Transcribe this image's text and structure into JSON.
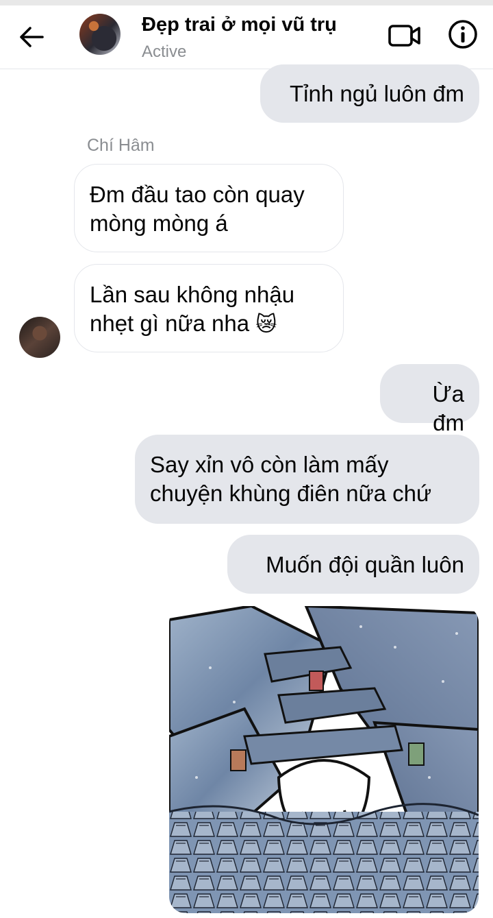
{
  "header": {
    "contact_name": "Đẹp trai ở mọi vũ trụ",
    "status": "Active",
    "back_icon": "arrow-left-icon",
    "video_icon": "video-camera-icon",
    "info_icon": "info-icon"
  },
  "messages": [
    {
      "direction": "outgoing",
      "text": "Tỉnh ngủ luôn đm"
    },
    {
      "sender": "Chí Hâm"
    },
    {
      "direction": "incoming",
      "lines": [
        "Đm đầu tao còn quay",
        "mòng mòng á"
      ]
    },
    {
      "direction": "incoming",
      "lines": [
        "Lần sau không nhậu",
        "nhẹt gì nữa nha"
      ],
      "emoji": "😿"
    },
    {
      "direction": "outgoing",
      "text": "Ừa đm"
    },
    {
      "direction": "outgoing",
      "lines": [
        "Say xỉn vô còn làm mấy",
        "chuyện khùng điên nữa chứ"
      ]
    },
    {
      "direction": "outgoing",
      "text": "Muốn đội quần luôn"
    },
    {
      "direction": "outgoing",
      "type": "sticker",
      "icon": "jeans-pile-meme-sticker"
    }
  ],
  "colors": {
    "outgoing_bubble": "#e4e6eb",
    "secondary_text": "#8a8d91",
    "primary_text": "#050505"
  }
}
